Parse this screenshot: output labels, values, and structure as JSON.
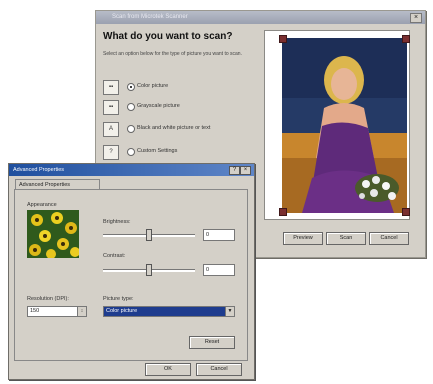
{
  "scan_dialog": {
    "title": "Scan from Microtek Scanner",
    "heading": "What do you want to scan?",
    "subtext": "Select an option below for the type of picture you want to scan.",
    "options": [
      {
        "label": "Color picture",
        "icon": "color-picture-icon",
        "selected": true
      },
      {
        "label": "Grayscale picture",
        "icon": "grayscale-picture-icon",
        "selected": false
      },
      {
        "label": "Black and white picture or text",
        "icon": "bw-text-icon",
        "selected": false
      },
      {
        "label": "Custom Settings",
        "icon": "custom-settings-icon",
        "selected": false
      }
    ],
    "buttons": {
      "preview": "Preview",
      "scan": "Scan",
      "cancel": "Cancel"
    }
  },
  "advanced_dialog": {
    "title": "Advanced Properties",
    "tab": "Advanced Properties",
    "appearance_label": "Appearance",
    "brightness_label": "Brightness:",
    "brightness_value": "0",
    "contrast_label": "Contrast:",
    "contrast_value": "0",
    "resolution_label": "Resolution (DPI):",
    "resolution_value": "150",
    "picture_type_label": "Picture type:",
    "picture_type_value": "Color picture",
    "reset_label": "Reset",
    "ok_label": "OK",
    "cancel_label": "Cancel",
    "brightness_level": 0.5,
    "contrast_level": 0.5
  },
  "colors": {
    "active_title": "#1f4f9e",
    "inactive_title": "#9ba1b0",
    "window_face": "#d4d0c8",
    "selection": "#1e3c8e"
  }
}
